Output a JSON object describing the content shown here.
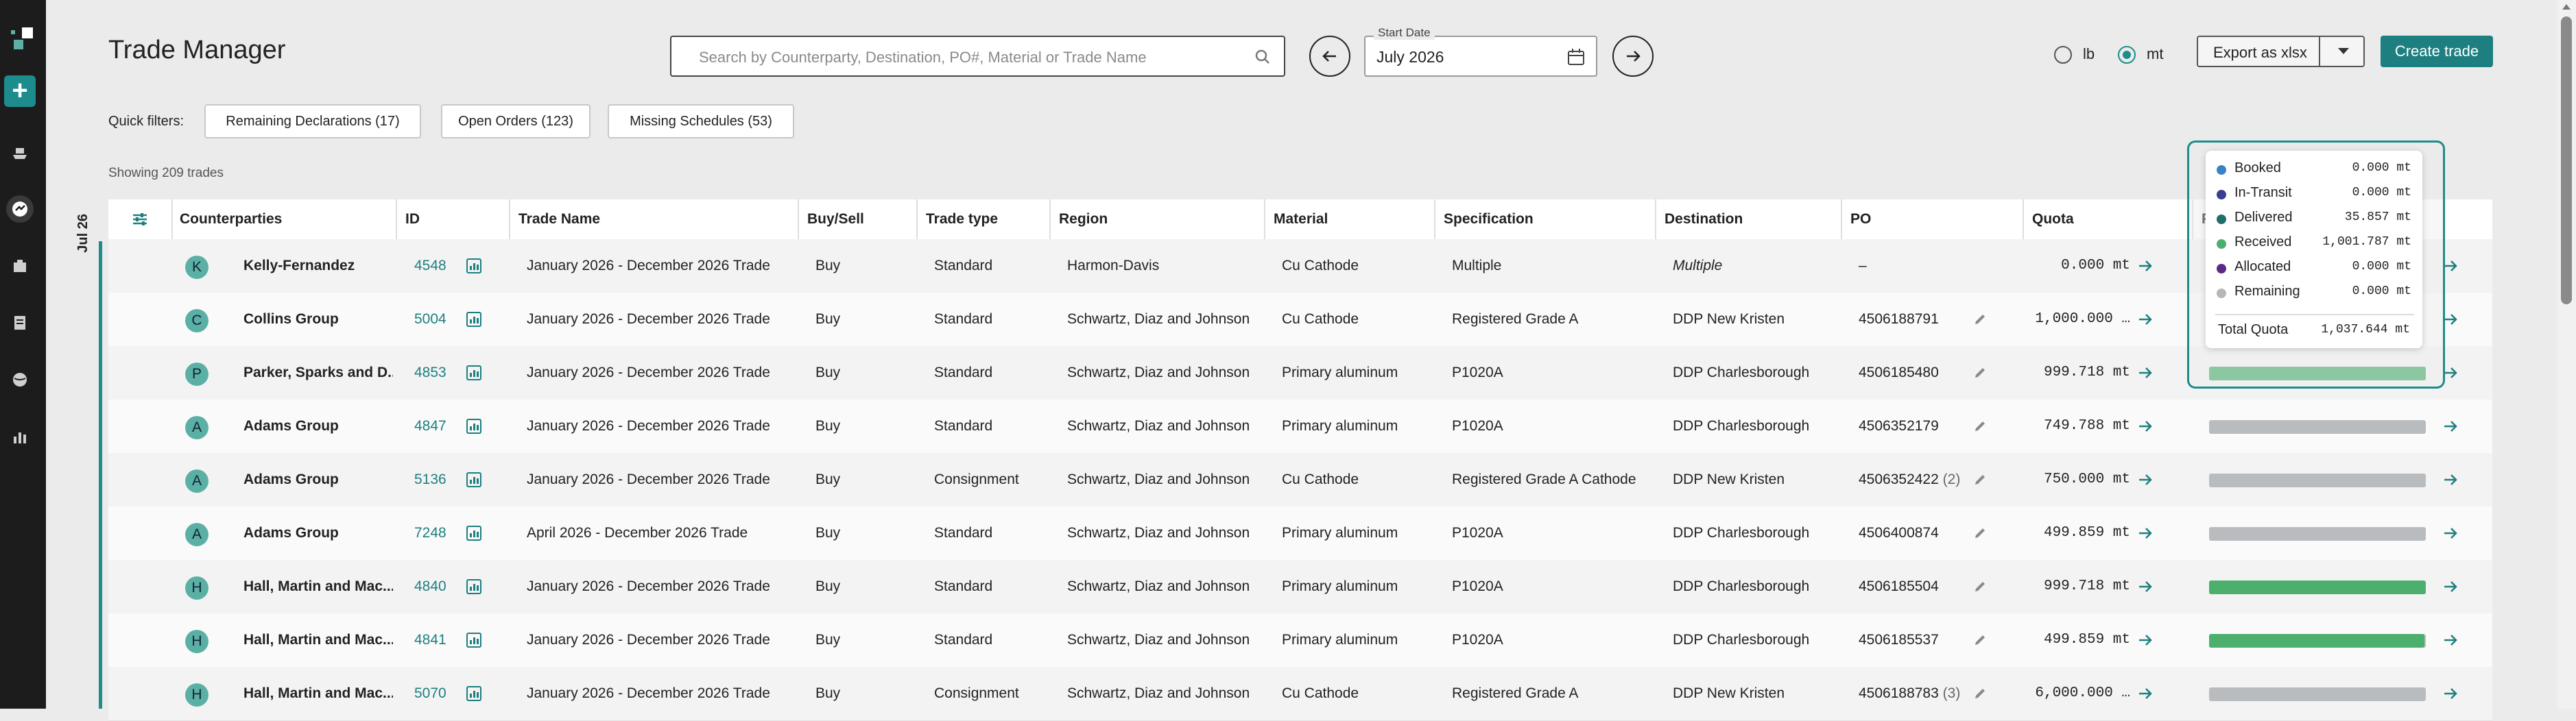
{
  "app": {
    "title": "Trade Manager"
  },
  "search": {
    "placeholder": "Search by Counterparty, Destination, PO#, Material or Trade Name"
  },
  "date_picker": {
    "label": "Start Date",
    "value": "July 2026"
  },
  "units": {
    "options": [
      "lb",
      "mt"
    ],
    "selected": "mt"
  },
  "actions": {
    "export_label": "Export as xlsx",
    "create_label": "Create trade"
  },
  "quick_filters": {
    "label": "Quick filters:",
    "chips": [
      "Remaining Declarations (17)",
      "Open Orders (123)",
      "Missing Schedules (53)"
    ]
  },
  "summary": {
    "showing": "Showing 209 trades"
  },
  "month_marker": "Jul 26",
  "columns": [
    "Counterparties",
    "ID",
    "Trade Name",
    "Buy/Sell",
    "Trade type",
    "Region",
    "Material",
    "Specification",
    "Destination",
    "PO",
    "Quota",
    "P"
  ],
  "rows": [
    {
      "initial": "K",
      "counterparty": "Kelly-Fernandez",
      "id": "4548",
      "trade_name": "January 2026 - December 2026 Trade",
      "buy_sell": "Buy",
      "trade_type": "Standard",
      "region": "Harmon-Davis",
      "material": "Cu Cathode",
      "specification": "Multiple",
      "destination": "Multiple",
      "po": "–",
      "po_count": "",
      "quota": "0.000 mt",
      "progress": 0,
      "show_bar": false
    },
    {
      "initial": "C",
      "counterparty": "Collins Group",
      "id": "5004",
      "trade_name": "January 2026 - December 2026 Trade",
      "buy_sell": "Buy",
      "trade_type": "Standard",
      "region": "Schwartz, Diaz and Johnson",
      "material": "Cu Cathode",
      "specification": "Registered Grade A",
      "destination": "DDP New Kristen",
      "po": "4506188791",
      "po_count": "",
      "quota": "1,000.000 …",
      "progress": 0.01,
      "show_bar": false
    },
    {
      "initial": "P",
      "counterparty": "Parker, Sparks and D...",
      "id": "4853",
      "trade_name": "January 2026 - December 2026 Trade",
      "buy_sell": "Buy",
      "trade_type": "Standard",
      "region": "Schwartz, Diaz and Johnson",
      "material": "Primary aluminum",
      "specification": "P1020A",
      "destination": "DDP Charlesborough",
      "po": "4506185480",
      "po_count": "",
      "quota": "999.718 mt",
      "progress": 1.0,
      "show_bar": true
    },
    {
      "initial": "A",
      "counterparty": "Adams Group",
      "id": "4847",
      "trade_name": "January 2026 - December 2026 Trade",
      "buy_sell": "Buy",
      "trade_type": "Standard",
      "region": "Schwartz, Diaz and Johnson",
      "material": "Primary aluminum",
      "specification": "P1020A",
      "destination": "DDP Charlesborough",
      "po": "4506352179",
      "po_count": "",
      "quota": "749.788 mt",
      "progress": 0,
      "show_bar": true
    },
    {
      "initial": "A",
      "counterparty": "Adams Group",
      "id": "5136",
      "trade_name": "January 2026 - December 2026 Trade",
      "buy_sell": "Buy",
      "trade_type": "Consignment",
      "region": "Schwartz, Diaz and Johnson",
      "material": "Cu Cathode",
      "specification": "Registered Grade A Cathode",
      "destination": "DDP New Kristen",
      "po": "4506352422",
      "po_count": "(2)",
      "quota": "750.000 mt",
      "progress": 0,
      "show_bar": true
    },
    {
      "initial": "A",
      "counterparty": "Adams Group",
      "id": "7248",
      "trade_name": "April 2026 - December 2026 Trade",
      "buy_sell": "Buy",
      "trade_type": "Standard",
      "region": "Schwartz, Diaz and Johnson",
      "material": "Primary aluminum",
      "specification": "P1020A",
      "destination": "DDP Charlesborough",
      "po": "4506400874",
      "po_count": "",
      "quota": "499.859 mt",
      "progress": 0,
      "show_bar": true
    },
    {
      "initial": "H",
      "counterparty": "Hall, Martin and Mac...",
      "id": "4840",
      "trade_name": "January 2026 - December 2026 Trade",
      "buy_sell": "Buy",
      "trade_type": "Standard",
      "region": "Schwartz, Diaz and Johnson",
      "material": "Primary aluminum",
      "specification": "P1020A",
      "destination": "DDP Charlesborough",
      "po": "4506185504",
      "po_count": "",
      "quota": "999.718 mt",
      "progress": 1.0,
      "show_bar": true
    },
    {
      "initial": "H",
      "counterparty": "Hall, Martin and Mac...",
      "id": "4841",
      "trade_name": "January 2026 - December 2026 Trade",
      "buy_sell": "Buy",
      "trade_type": "Standard",
      "region": "Schwartz, Diaz and Johnson",
      "material": "Primary aluminum",
      "specification": "P1020A",
      "destination": "DDP Charlesborough",
      "po": "4506185537",
      "po_count": "",
      "quota": "499.859 mt",
      "progress": 0.995,
      "show_bar": true
    },
    {
      "initial": "H",
      "counterparty": "Hall, Martin and Mac...",
      "id": "5070",
      "trade_name": "January 2026 - December 2026 Trade",
      "buy_sell": "Buy",
      "trade_type": "Consignment",
      "region": "Schwartz, Diaz and Johnson",
      "material": "Cu Cathode",
      "specification": "Registered Grade A",
      "destination": "DDP New Kristen",
      "po": "4506188783",
      "po_count": "(3)",
      "quota": "6,000.000 …",
      "progress": 0,
      "show_bar": true
    }
  ],
  "tooltip": {
    "items": [
      {
        "name": "Booked",
        "value": "0.000 mt",
        "color": "#3b82c4"
      },
      {
        "name": "In-Transit",
        "value": "0.000 mt",
        "color": "#3a3f8f"
      },
      {
        "name": "Delivered",
        "value": "35.857 mt",
        "color": "#1f6f6a"
      },
      {
        "name": "Received",
        "value": "1,001.787 mt",
        "color": "#4caf6e"
      },
      {
        "name": "Allocated",
        "value": "0.000 mt",
        "color": "#5b2a86"
      },
      {
        "name": "Remaining",
        "value": "0.000 mt",
        "color": "#b5b8bb"
      }
    ],
    "total_label": "Total Quota",
    "total_value": "1,037.644 mt"
  },
  "colors": {
    "accent": "#1d8c8c",
    "primary_button": "#1d7f80",
    "bar_received": "#4caf6e",
    "bar_track": "#b9bcbf"
  }
}
